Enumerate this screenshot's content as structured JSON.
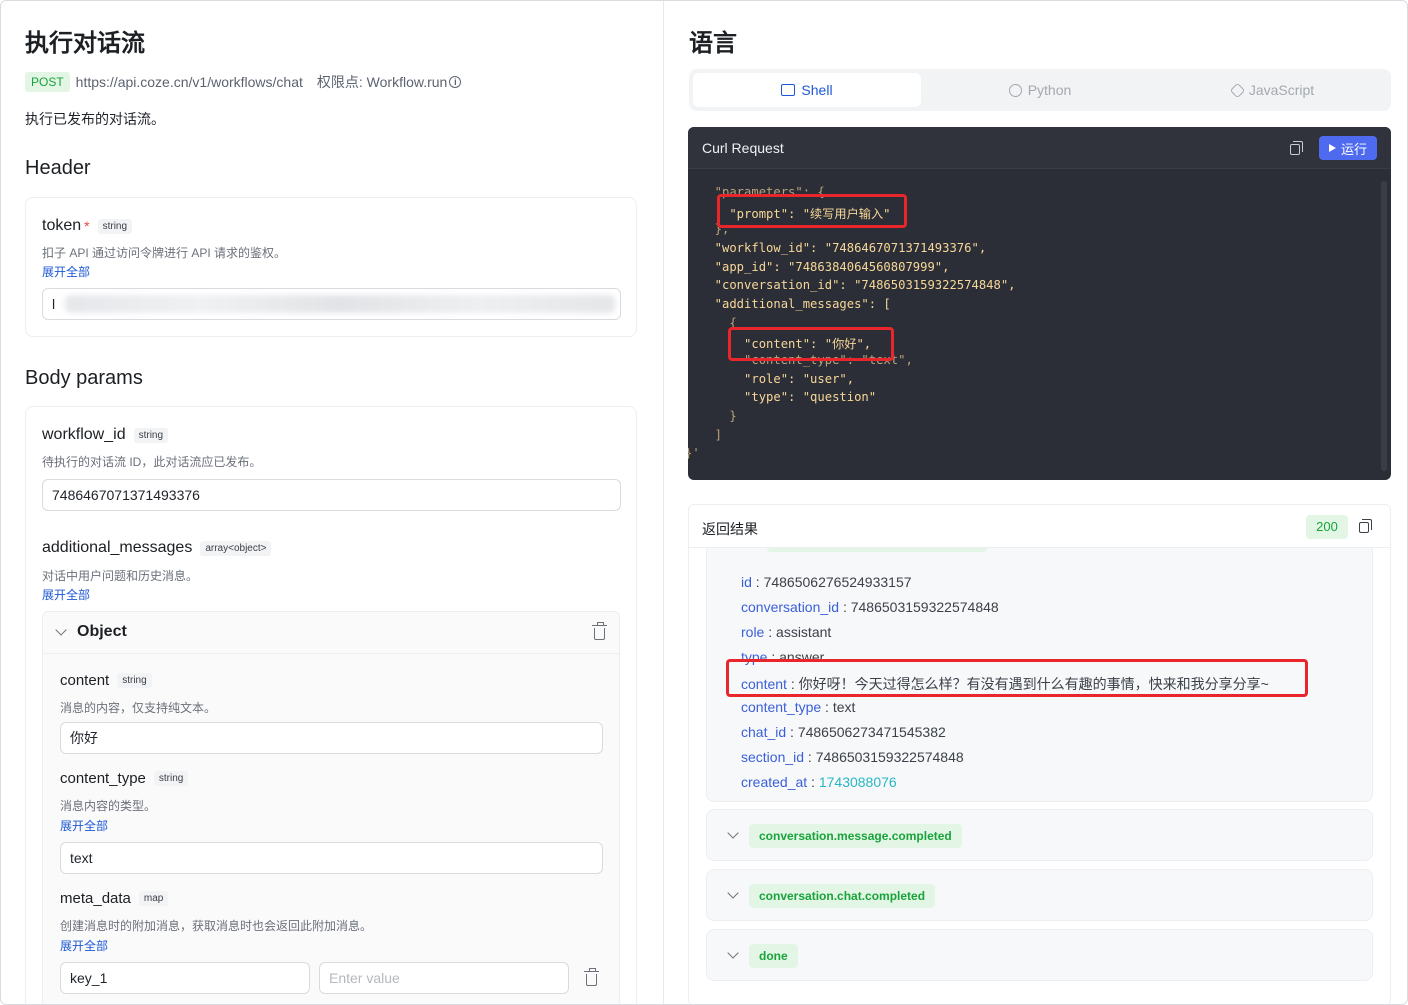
{
  "left": {
    "title": "执行对话流",
    "method": "POST",
    "url": "https://api.coze.cn/v1/workflows/chat",
    "permission": "权限点: Workflow.run",
    "info_glyph": "i",
    "description": "执行已发布的对话流。",
    "header_section": "Header",
    "token": {
      "name": "token",
      "required_mark": "*",
      "type": "string",
      "desc": "扣子 API 通过访问令牌进行 API 请求的鉴权。",
      "expand": "展开全部",
      "value": "l"
    },
    "body_section": "Body params",
    "workflow_id": {
      "name": "workflow_id",
      "type": "string",
      "desc": "待执行的对话流 ID，此对话流应已发布。",
      "value": "7486467071371493376"
    },
    "additional_messages": {
      "name": "additional_messages",
      "type": "array<object>",
      "desc": "对话中用户问题和历史消息。",
      "expand": "展开全部"
    },
    "object": {
      "title": "Object",
      "content": {
        "name": "content",
        "type": "string",
        "desc": "消息的内容，仅支持纯文本。",
        "value": "你好"
      },
      "content_type": {
        "name": "content_type",
        "type": "string",
        "desc": "消息内容的类型。",
        "expand": "展开全部",
        "value": "text"
      },
      "meta_data": {
        "name": "meta_data",
        "type": "map",
        "desc": "创建消息时的附加消息，获取消息时也会返回此附加消息。",
        "expand": "展开全部",
        "key_value": "key_1",
        "value_placeholder": "Enter value"
      }
    }
  },
  "right": {
    "title": "语言",
    "tabs": [
      {
        "label": "Shell",
        "icon": "terminal-icon",
        "active": true
      },
      {
        "label": "Python",
        "icon": "python-icon",
        "active": false
      },
      {
        "label": "JavaScript",
        "icon": "javascript-icon",
        "active": false
      }
    ],
    "code": {
      "title": "Curl Request",
      "run_label": "运行",
      "lines": [
        "  \"parameters\": {",
        "    \"prompt\": \"续写用户输入\"",
        "  },",
        "  \"workflow_id\": \"7486467071371493376\",",
        "  \"app_id\": \"7486384064560807999\",",
        "  \"conversation_id\": \"7486503159322574848\",",
        "  \"additional_messages\": [",
        "    {",
        "      \"content\": \"你好\",",
        "      \"content_type\": \"text\",",
        "      \"role\": \"user\",",
        "      \"type\": \"question\"",
        "    }",
        "  ]",
        "}'"
      ]
    },
    "result": {
      "title": "返回结果",
      "status": "200",
      "fields": [
        {
          "k": "id",
          "v": "7486506276524933157"
        },
        {
          "k": "conversation_id",
          "v": "7486503159322574848"
        },
        {
          "k": "role",
          "v": "assistant"
        },
        {
          "k": "type",
          "v": "answer"
        },
        {
          "k": "content",
          "v": "你好呀！今天过得怎么样？有没有遇到什么有趣的事情，快来和我分享分享~"
        },
        {
          "k": "content_type",
          "v": "text"
        },
        {
          "k": "chat_id",
          "v": "7486506273471545382"
        },
        {
          "k": "section_id",
          "v": "7486503159322574848"
        },
        {
          "k": "created_at",
          "v": "1743088076"
        }
      ],
      "separator": " : ",
      "events": [
        "conversation.message.completed",
        "conversation.chat.completed",
        "done"
      ]
    }
  },
  "colors": {
    "accent": "#1d58d6",
    "success": "#19a33b",
    "highlight": "#e8262b",
    "code_bg": "#2b2e36",
    "run_button": "#4e6bf0"
  }
}
